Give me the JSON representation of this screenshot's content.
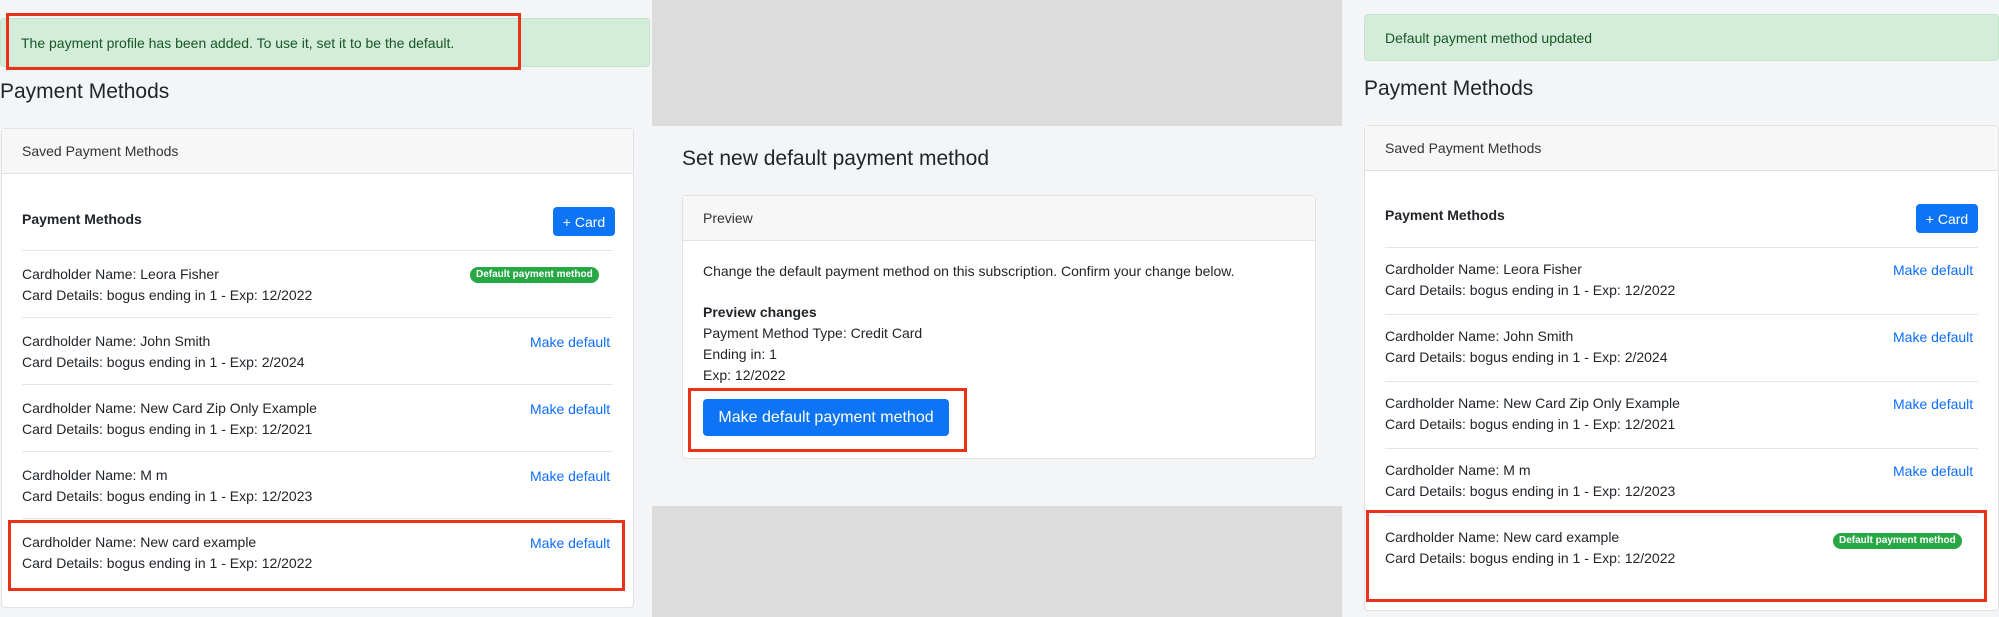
{
  "left": {
    "alert": "The payment profile has been added. To use it, set it to be the default.",
    "title": "Payment Methods",
    "card_header": "Saved Payment Methods",
    "section_title": "Payment Methods",
    "add_button": "+ Card",
    "rows": [
      {
        "name": "Cardholder Name: Leora Fisher",
        "details": "Card Details: bogus ending in 1 - Exp: 12/2022",
        "badge": "Default payment method"
      },
      {
        "name": "Cardholder Name: John Smith",
        "details": "Card Details: bogus ending in 1 - Exp: 2/2024",
        "action": "Make default"
      },
      {
        "name": "Cardholder Name: New Card Zip Only Example",
        "details": "Card Details: bogus ending in 1 - Exp: 12/2021",
        "action": "Make default"
      },
      {
        "name": "Cardholder Name: M m",
        "details": "Card Details: bogus ending in 1 - Exp: 12/2023",
        "action": "Make default"
      },
      {
        "name": "Cardholder Name: New card example",
        "details": "Card Details: bogus ending in 1 - Exp: 12/2022",
        "action": "Make default"
      }
    ]
  },
  "middle": {
    "title": "Set new default payment method",
    "card_header": "Preview",
    "description": "Change the default payment method on this subscription. Confirm your change below.",
    "preview_heading": "Preview changes",
    "payment_type": "Payment Method Type: Credit Card",
    "ending": "Ending in: 1",
    "exp": "Exp: 12/2022",
    "confirm_button": "Make default payment method"
  },
  "right": {
    "alert": "Default payment method updated",
    "title": "Payment Methods",
    "card_header": "Saved Payment Methods",
    "section_title": "Payment Methods",
    "add_button": "+ Card",
    "rows": [
      {
        "name": "Cardholder Name: Leora Fisher",
        "details": "Card Details: bogus ending in 1 - Exp: 12/2022",
        "action": "Make default"
      },
      {
        "name": "Cardholder Name: John Smith",
        "details": "Card Details: bogus ending in 1 - Exp: 2/2024",
        "action": "Make default"
      },
      {
        "name": "Cardholder Name: New Card Zip Only Example",
        "details": "Card Details: bogus ending in 1 - Exp: 12/2021",
        "action": "Make default"
      },
      {
        "name": "Cardholder Name: M m",
        "details": "Card Details: bogus ending in 1 - Exp: 12/2023",
        "action": "Make default"
      },
      {
        "name": "Cardholder Name: New card example",
        "details": "Card Details: bogus ending in 1 - Exp: 12/2022",
        "badge": "Default payment method"
      }
    ]
  },
  "colors": {
    "primary": "#0d74f5",
    "link": "#0d6efd",
    "success_badge": "#28a745",
    "alert_bg": "#d4edda",
    "highlight": "#e8321a"
  }
}
